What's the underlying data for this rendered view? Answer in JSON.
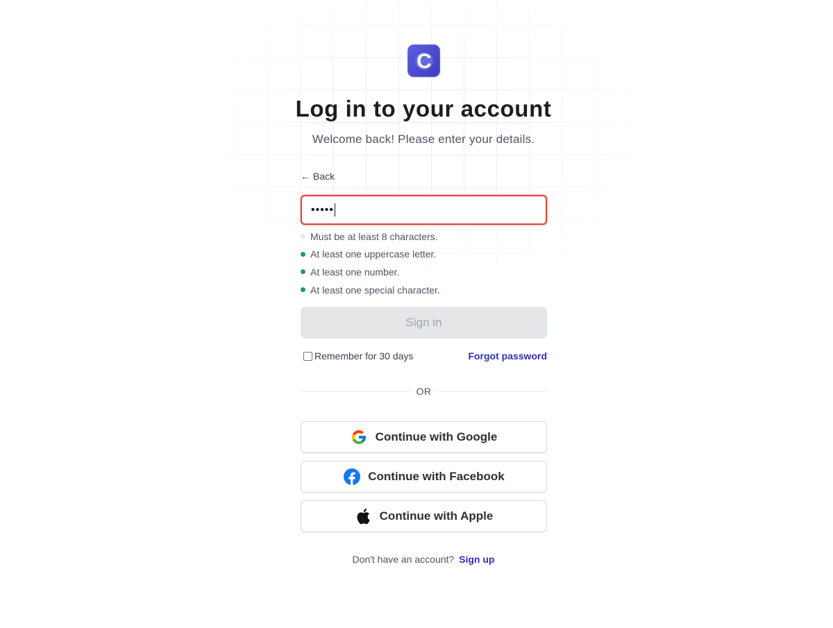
{
  "brand": {
    "logo_letter": "C",
    "logo_colors": {
      "start": "#5b5fe0",
      "end": "#3f3ac2"
    }
  },
  "header": {
    "title": "Log in to your account",
    "subtitle": "Welcome back! Please enter your details."
  },
  "form": {
    "back_label": "Back",
    "password_value": "•••••",
    "password_border_color": "#e0443e",
    "rules": [
      {
        "text": "Must be at least 8 characters.",
        "met": false
      },
      {
        "text": "At least one uppercase letter.",
        "met": true
      },
      {
        "text": "At least one number.",
        "met": true
      },
      {
        "text": "At least one special character.",
        "met": true
      }
    ],
    "signin_label": "Sign in",
    "signin_disabled": true,
    "remember_label": "Remember for 30 days",
    "remember_checked": false,
    "forgot_label": "Forgot password"
  },
  "divider": {
    "label": "OR"
  },
  "social": {
    "google_label": "Continue with Google",
    "facebook_label": "Continue with Facebook",
    "apple_label": "Continue with Apple"
  },
  "footer": {
    "prompt": "Don't have an account?",
    "signup_label": "Sign up"
  },
  "colors": {
    "link": "#2f2fb8",
    "rule_ok": "#1f9d55",
    "rule_pending": "#e5e7eb",
    "facebook_blue": "#1877f2"
  }
}
